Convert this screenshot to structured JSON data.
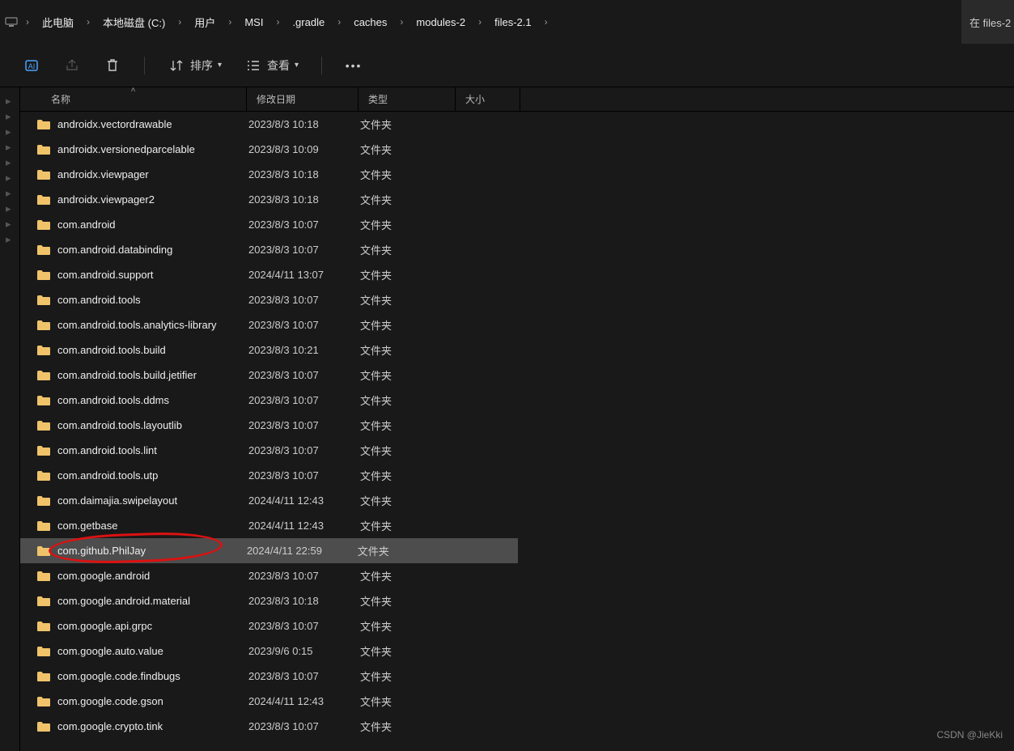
{
  "breadcrumb": [
    "此电脑",
    "本地磁盘 (C:)",
    "用户",
    "MSI",
    ".gradle",
    "caches",
    "modules-2",
    "files-2.1"
  ],
  "search_placeholder": "在 files-2",
  "toolbar": {
    "sort_label": "排序",
    "view_label": "查看"
  },
  "columns": {
    "name": "名称",
    "modified": "修改日期",
    "type": "类型",
    "size": "大小"
  },
  "type_folder": "文件夹",
  "selected_index": 17,
  "watermark": "CSDN @JieKki",
  "items": [
    {
      "n": "androidx.vectordrawable",
      "d": "2023/8/3 10:18"
    },
    {
      "n": "androidx.versionedparcelable",
      "d": "2023/8/3 10:09"
    },
    {
      "n": "androidx.viewpager",
      "d": "2023/8/3 10:18"
    },
    {
      "n": "androidx.viewpager2",
      "d": "2023/8/3 10:18"
    },
    {
      "n": "com.android",
      "d": "2023/8/3 10:07"
    },
    {
      "n": "com.android.databinding",
      "d": "2023/8/3 10:07"
    },
    {
      "n": "com.android.support",
      "d": "2024/4/11 13:07"
    },
    {
      "n": "com.android.tools",
      "d": "2023/8/3 10:07"
    },
    {
      "n": "com.android.tools.analytics-library",
      "d": "2023/8/3 10:07"
    },
    {
      "n": "com.android.tools.build",
      "d": "2023/8/3 10:21"
    },
    {
      "n": "com.android.tools.build.jetifier",
      "d": "2023/8/3 10:07"
    },
    {
      "n": "com.android.tools.ddms",
      "d": "2023/8/3 10:07"
    },
    {
      "n": "com.android.tools.layoutlib",
      "d": "2023/8/3 10:07"
    },
    {
      "n": "com.android.tools.lint",
      "d": "2023/8/3 10:07"
    },
    {
      "n": "com.android.tools.utp",
      "d": "2023/8/3 10:07"
    },
    {
      "n": "com.daimajia.swipelayout",
      "d": "2024/4/11 12:43"
    },
    {
      "n": "com.getbase",
      "d": "2024/4/11 12:43"
    },
    {
      "n": "com.github.PhilJay",
      "d": "2024/4/11 22:59"
    },
    {
      "n": "com.google.android",
      "d": "2023/8/3 10:07"
    },
    {
      "n": "com.google.android.material",
      "d": "2023/8/3 10:18"
    },
    {
      "n": "com.google.api.grpc",
      "d": "2023/8/3 10:07"
    },
    {
      "n": "com.google.auto.value",
      "d": "2023/9/6 0:15"
    },
    {
      "n": "com.google.code.findbugs",
      "d": "2023/8/3 10:07"
    },
    {
      "n": "com.google.code.gson",
      "d": "2024/4/11 12:43"
    },
    {
      "n": "com.google.crypto.tink",
      "d": "2023/8/3 10:07"
    }
  ]
}
